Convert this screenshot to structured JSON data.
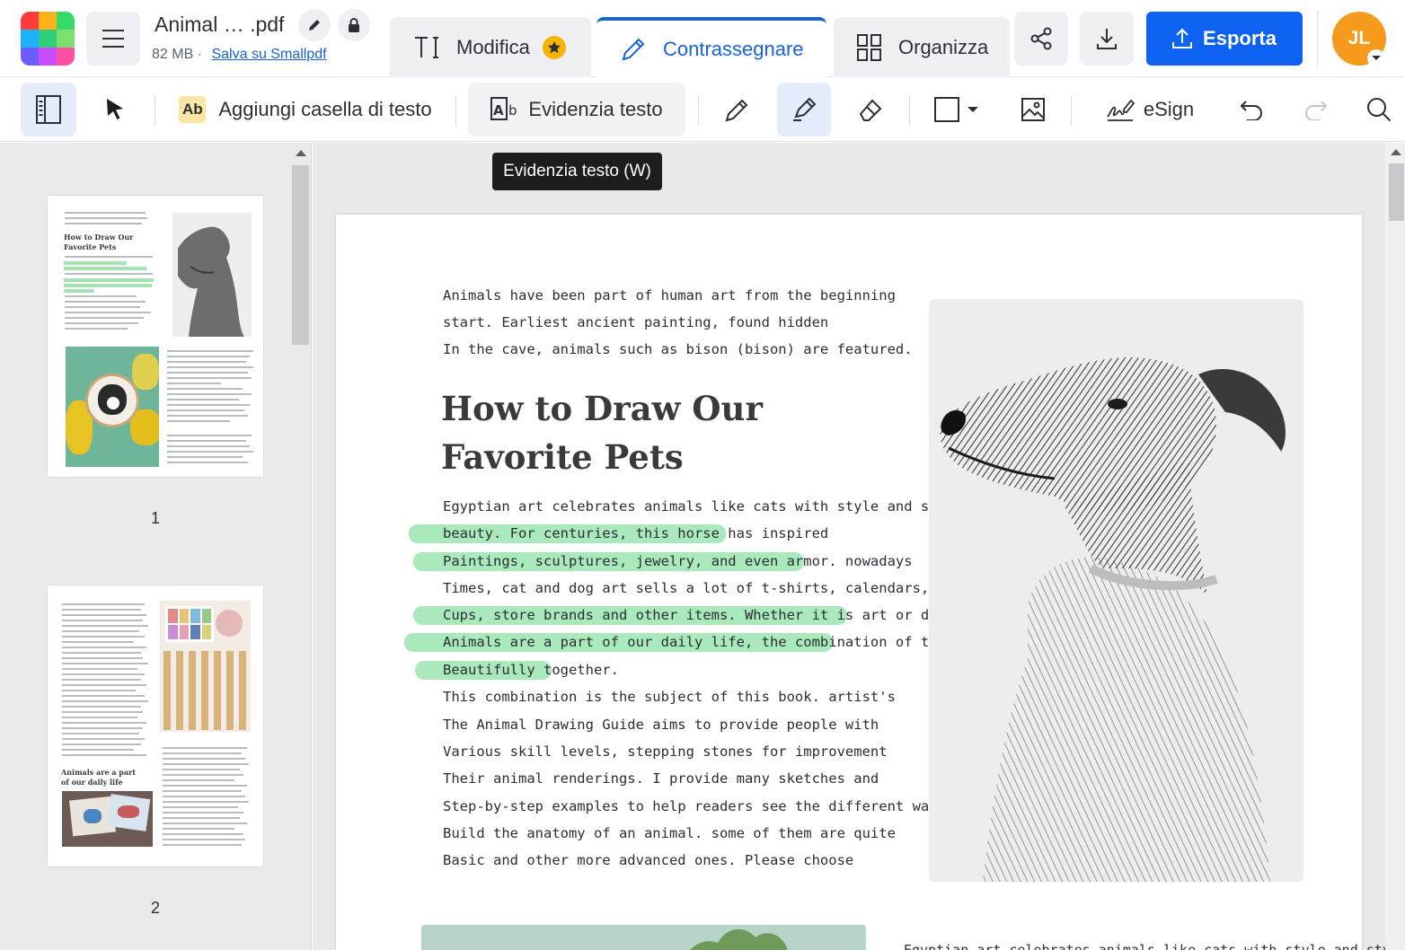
{
  "header": {
    "file_name": "Animal … .pdf",
    "file_size": "82 MB",
    "separator": "·",
    "save_link": "Salva su Smallpdf",
    "tabs": [
      {
        "label": "Modifica",
        "icon": "text-edit-icon",
        "badge": "star-icon"
      },
      {
        "label": "Contrassegnare",
        "icon": "pencil-icon",
        "active": true
      },
      {
        "label": "Organizza",
        "icon": "grid-icon"
      }
    ],
    "export_label": "Esporta",
    "avatar_initials": "JL",
    "accent": "#0d62f2",
    "avatar_color": "#f59a1b"
  },
  "toolbar": {
    "add_textbox": "Aggiungi casella di testo",
    "ab_chip": "Ab",
    "highlight_text": "Evidenzia testo",
    "esign": "eSign",
    "tooltip": "Evidenzia testo (W)"
  },
  "sidebar": {
    "pages": [
      {
        "number": "1"
      },
      {
        "number": "2"
      }
    ],
    "thumb2_heading": "Animals are a part of our daily life",
    "thumb1_heading": "How to Draw Our Favorite Pets"
  },
  "document": {
    "intro": [
      "Animals have been part of human art from the beginning",
      "start. Earliest ancient painting, found hidden",
      "In the cave, animals such as bison (bison) are featured."
    ],
    "title_line1": "How to Draw Our",
    "title_line2": "Favorite Pets",
    "body": [
      {
        "text": "Egyptian art celebrates animals like cats with style and style",
        "highlight": false
      },
      {
        "text": "beauty. For centuries, this horse has inspired",
        "highlight": true
      },
      {
        "text": "Paintings, sculptures, jewelry, and even armor. nowadays",
        "highlight": true
      },
      {
        "text": "Times, cat and dog art sells a lot of t-shirts, calendars, coffee",
        "highlight": false
      },
      {
        "text": "Cups, store brands and other items. Whether it is art or domestic",
        "highlight": true
      },
      {
        "text": "Animals are a part of our daily life, the combination of the two",
        "highlight": true
      },
      {
        "text": "Beautifully together.",
        "highlight": true
      },
      {
        "text": "This combination is the subject of this book. artist's",
        "highlight": false
      },
      {
        "text": "The Animal Drawing Guide aims to provide people with",
        "highlight": false
      },
      {
        "text": "Various skill levels, stepping stones for improvement",
        "highlight": false
      },
      {
        "text": "Their animal renderings. I provide many sketches and",
        "highlight": false
      },
      {
        "text": "Step-by-step examples to help readers see the different ways",
        "highlight": false
      },
      {
        "text": "Build the anatomy of an animal. some of them are quite",
        "highlight": false
      },
      {
        "text": "Basic and other more advanced ones. Please choose",
        "highlight": false
      }
    ],
    "bottom_cut_text": "Egyptian art celebrates animals like cats with style and style",
    "highlight_color": "#a9e9bb"
  }
}
